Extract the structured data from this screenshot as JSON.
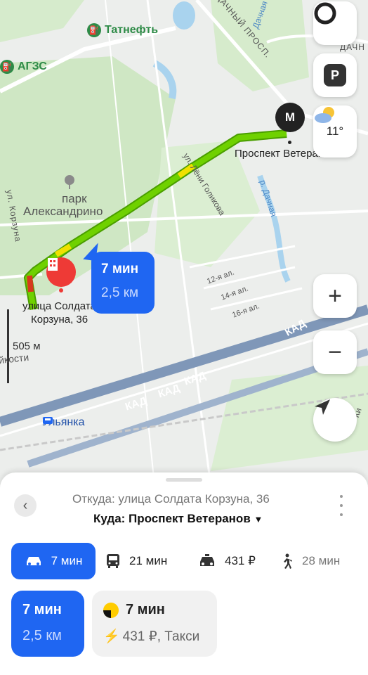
{
  "map": {
    "poi_tatneft": "Татнефть",
    "poi_agzs": "АГЗС",
    "street_dachny": "ДАЧНЫЙ ПРОСП.",
    "street_dachnaya_top": "Дачная",
    "street_dachny_right": "ДАЧН",
    "park_line1": "парк",
    "park_line2": "Александрино",
    "street_korzuna": "ул. Корзуна",
    "street_goleykova": "ул. Лёни Голикова",
    "river_dachnaya": "р. Дачная",
    "alley_12": "12-я ал.",
    "alley_14": "14-я ал.",
    "alley_16": "16-я ал.",
    "kad_1": "КАД",
    "kad_2": "КАД",
    "kad_3": "КАД",
    "kad_4": "КАД",
    "metro_marker": "М",
    "destination_label": "Проспект Ветеранов",
    "origin_line1": "улица Солдата",
    "origin_line2": "Корзуна, 36",
    "scale": "505 м",
    "street_doblesti": "йкости",
    "station": "Ульянка",
    "right_edge_text": "Ки",
    "temperature": "11°",
    "route_time": "7 мин",
    "route_distance": "2,5 км"
  },
  "colors": {
    "accent": "#1f66f2",
    "route_green": "#6fd100",
    "route_yellow": "#f0e100",
    "route_red": "#d63a1c",
    "pin_red": "#ee3a36",
    "park": "#cfe7c4",
    "water": "#a9d3ee"
  },
  "sheet": {
    "from": "Откуда: улица Солдата Корзуна, 36",
    "to": "Куда: Проспект Ветеранов",
    "to_arrow": "▼",
    "modes": [
      {
        "icon": "car-icon",
        "label": "7 мин",
        "active": true
      },
      {
        "icon": "bus-icon",
        "label": "21 мин"
      },
      {
        "icon": "taxi-icon",
        "label": "431 ₽"
      },
      {
        "icon": "walk-icon",
        "label": "28 мин"
      }
    ],
    "main_card": {
      "time": "7 мин",
      "distance": "2,5 км"
    },
    "taxi_card": {
      "time": "7 мин",
      "price": "431 ₽, Такси"
    }
  }
}
